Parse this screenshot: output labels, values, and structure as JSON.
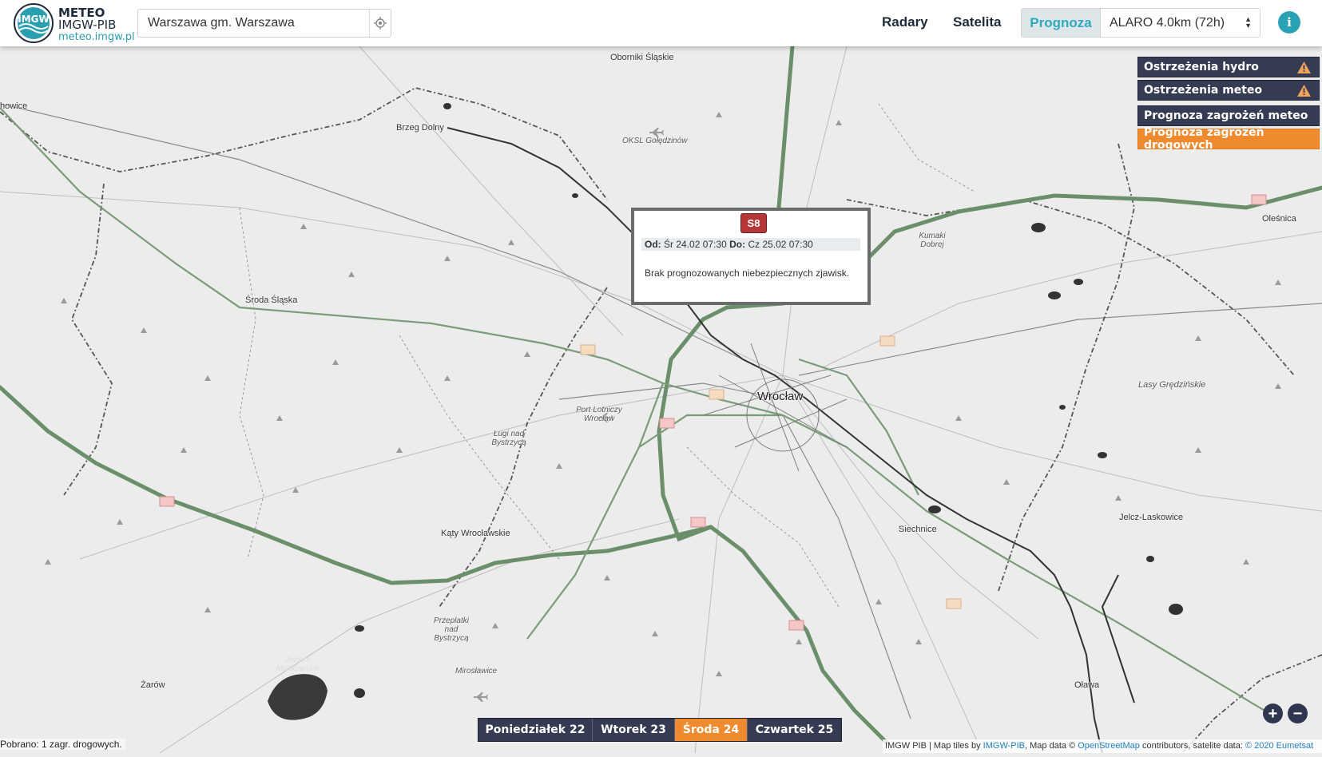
{
  "header": {
    "brand_line1": "METEO",
    "brand_line2": "IMGW-PIB",
    "brand_url": "meteo.imgw.pl",
    "logo_text": "IMGW",
    "search_value": "Warszawa gm. Warszawa",
    "nav_radary": "Radary",
    "nav_satelita": "Satelita",
    "tab_prognoza": "Prognoza",
    "model_selected": "ALARO 4.0km (72h)",
    "info_label": "i"
  },
  "right_panel": {
    "hydro": "Ostrzeżenia hydro",
    "meteo": "Ostrzeżenia meteo",
    "prognoza_meteo": "Prognoza zagrożeń meteo",
    "prognoza_drogowych": "Prognoza zagrożeń drogowych"
  },
  "popup": {
    "road": "S8",
    "od_label": "Od:",
    "od_value": "Śr 24.02 07:30",
    "do_label": "Do:",
    "do_value": "Cz 25.02 07:30",
    "message": "Brak prognozowanych niebezpiecznych zjawisk."
  },
  "days": [
    "Poniedziałek 22",
    "Wtorek 23",
    "Środa 24",
    "Czwartek 25"
  ],
  "active_day": "Środa 24",
  "map": {
    "places": {
      "oborniki": "Oborniki Śląskie",
      "brzeg_dolny": "Brzeg Dolny",
      "okl": "OKSL Gołędzinów",
      "olesnica": "Oleśnica",
      "kumaki": "Kumaki Dobrej",
      "sroda": "Środa Śląska",
      "wroclaw": "Wrocław",
      "port": "Port Lotniczy Wrocław",
      "legi": "Ługi nad Bystrzycą",
      "lasy": "Lasy Grędzińskie",
      "katy": "Kąty Wrocławskie",
      "siechnice": "Siechnice",
      "jelcz": "Jelcz-Laskowice",
      "przeplatki": "Przeplatki nad Bystrzycą",
      "jezioro": "Jezioro Mietkowskie",
      "mirosławice": "Mirosławice",
      "zarow": "Żarów",
      "olawa": "Oława",
      "chowice": "howice"
    }
  },
  "zoom": {
    "in": "+",
    "out": "−"
  },
  "status": "Pobrano: 1 zagr. drogowych.",
  "attribution": {
    "prefix": "IMGW PIB | Map tiles by",
    "imgw": "IMGW-PIB",
    "mapdata": ", Map data ©",
    "osm": "OpenStreetMap",
    "sat": "contributors, satelite data:",
    "eum": "© 2020 Eumetsat"
  }
}
